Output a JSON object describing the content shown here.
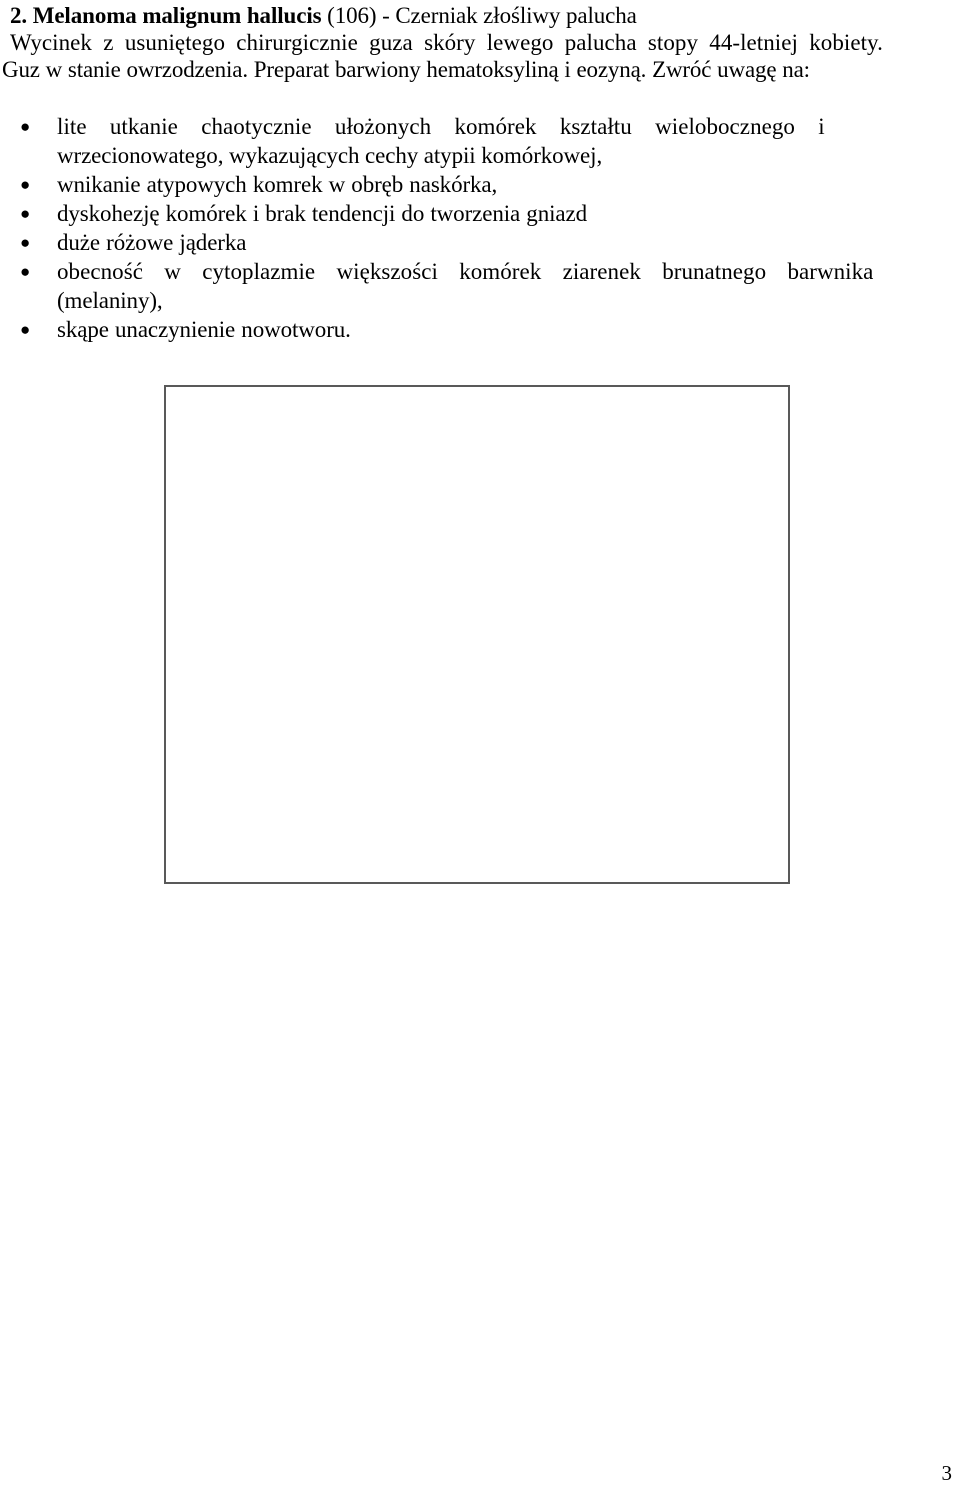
{
  "document": {
    "heading": {
      "number": "2.",
      "latin_name": "Melanoma malignum hallucis",
      "specimen_code_and_translation": "(106) - Czerniak złośliwy palucha",
      "title_full": "2. Melanoma malignum hallucis (106) - Czerniak złośliwy palucha"
    },
    "intro": {
      "line1": "Wycinek z usuniętego chirurgicznie guza skóry lewego palucha stopy 44-letniej kobiety.",
      "line2": "Guz w stanie owrzodzenia. Preparat barwiony hematoksyliną i eozyną. Zwróć uwagę na:"
    },
    "bullet_marker": "●",
    "bullets": [
      {
        "line1": "lite utkanie chaotycznie ułożonych komórek kształtu wielobocznego i",
        "line2": "wrzecionowatego, wykazujących cechy atypii komórkowej,"
      },
      {
        "line1": "wnikanie atypowych komrek w obręb naskórka,",
        "line2": ""
      },
      {
        "line1": "dyskohezję komórek i brak tendencji do tworzenia gniazd",
        "line2": ""
      },
      {
        "line1": "duże różowe jąderka",
        "line2": ""
      },
      {
        "line1": "obecność w cytoplazmie większości komórek ziarenek brunatnego barwnika",
        "line2": "(melaniny),"
      },
      {
        "line1": "skąpe unaczynienie nowotworu.",
        "line2": ""
      }
    ],
    "figure": {
      "caption": "",
      "border_color": "#595959"
    },
    "footer": {
      "page_number": "3"
    }
  }
}
